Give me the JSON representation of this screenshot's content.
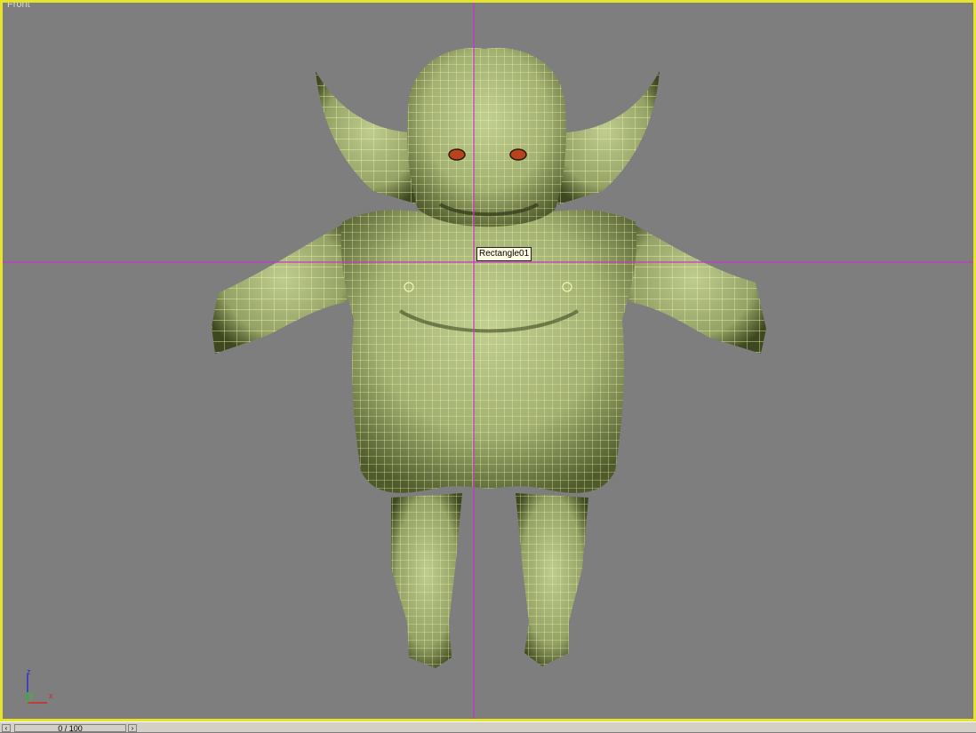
{
  "viewport": {
    "label": "Front",
    "border_color": "#e8e42c",
    "background_color": "#7e7e7e",
    "crosshair_color": "#cc33cc"
  },
  "selection_tooltip": "Rectangle01",
  "axis_tripod": {
    "z": "z",
    "y": "y",
    "x": "x"
  },
  "timeline": {
    "frame_display": "0 / 100",
    "prev_icon": "chevron-left-icon",
    "next_icon": "chevron-right-icon"
  },
  "model": {
    "mesh_color": "#a9b77c",
    "wire_color": "#f4f7a8",
    "eye_color": "#b8431c"
  }
}
